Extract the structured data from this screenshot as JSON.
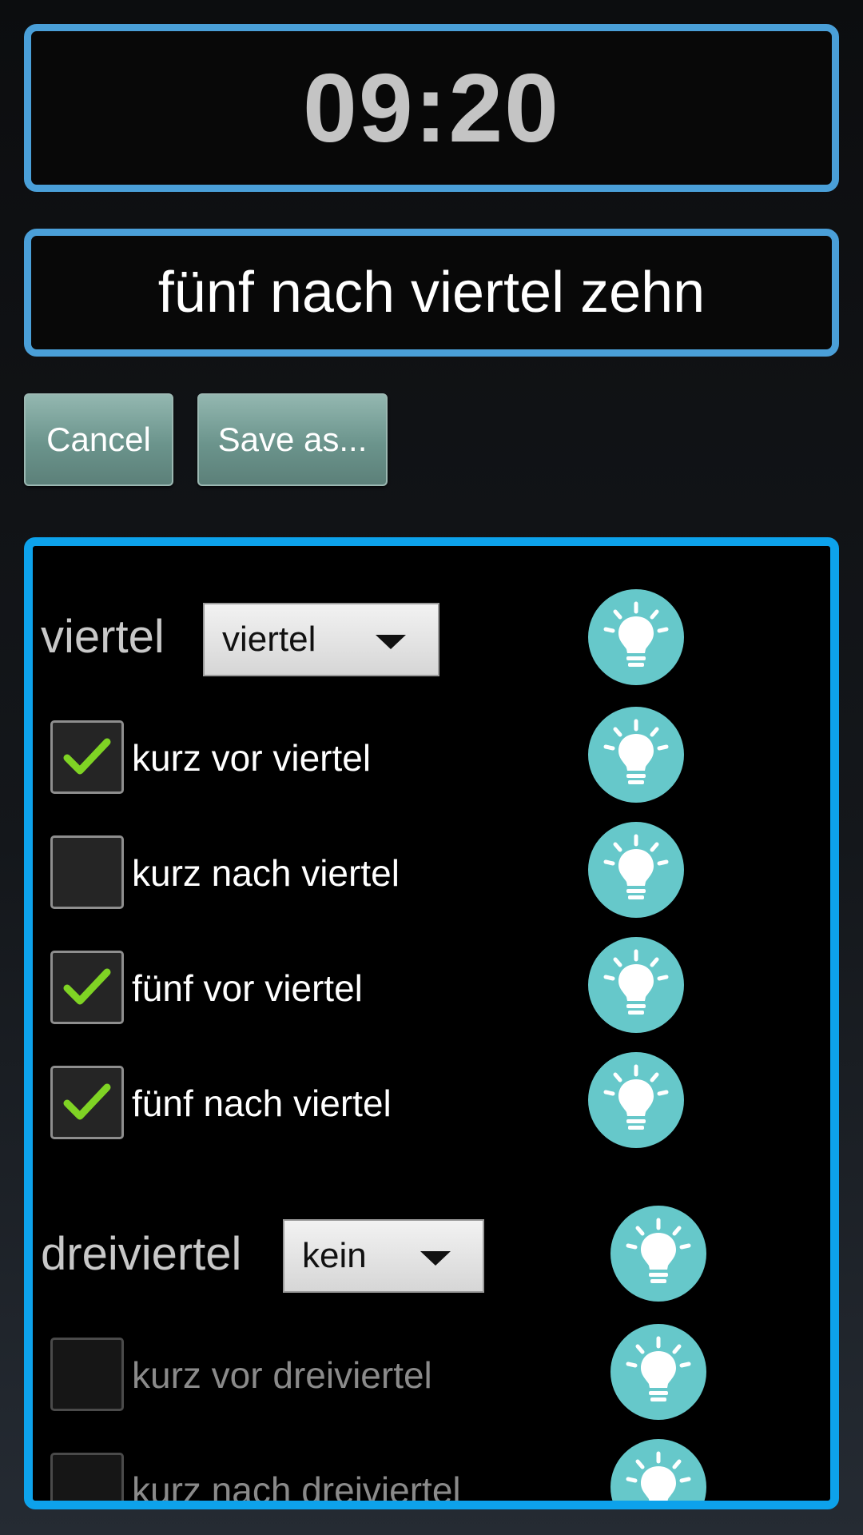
{
  "time": "09:20",
  "phrase": "fünf nach viertel zehn",
  "buttons": {
    "cancel": "Cancel",
    "save_as": "Save as..."
  },
  "sections": {
    "viertel": {
      "label": "viertel",
      "dropdown_value": "viertel",
      "options": [
        {
          "label": "kurz vor viertel",
          "checked": true
        },
        {
          "label": "kurz nach viertel",
          "checked": false
        },
        {
          "label": "fünf vor viertel",
          "checked": true
        },
        {
          "label": "fünf nach viertel",
          "checked": true
        }
      ]
    },
    "dreiviertel": {
      "label": "dreiviertel",
      "dropdown_value": "kein",
      "options": [
        {
          "label": "kurz vor dreiviertel",
          "checked": false,
          "enabled": false
        },
        {
          "label": "kurz nach dreiviertel",
          "checked": false,
          "enabled": false
        }
      ]
    }
  },
  "colors": {
    "frame_border": "#4a9fd8",
    "panel_border": "#0da2eb",
    "button_fill": "#6b948c",
    "bulb_fill": "#66c8ca",
    "check_mark": "#7fd324"
  },
  "icons": {
    "check": "checkmark-icon",
    "bulb": "lightbulb-icon",
    "dropdown": "triangle-down-icon"
  }
}
